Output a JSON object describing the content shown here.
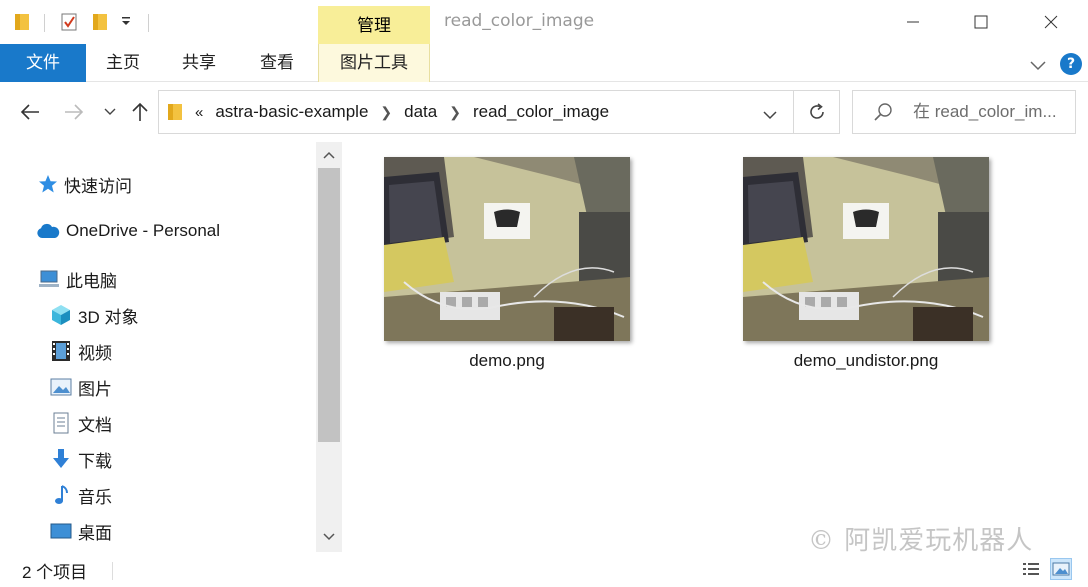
{
  "titlebar": {
    "context_tab": "管理",
    "window_title": "read_color_image"
  },
  "ribbon": {
    "tabs": [
      {
        "label": "文件"
      },
      {
        "label": "主页"
      },
      {
        "label": "共享"
      },
      {
        "label": "查看"
      },
      {
        "label": "图片工具"
      }
    ],
    "help_label": "?"
  },
  "address": {
    "lead": "«",
    "crumbs": [
      "astra-basic-example",
      "data",
      "read_color_image"
    ],
    "search_placeholder": "在 read_color_im..."
  },
  "nav": {
    "items": [
      {
        "label": "快速访问",
        "icon": "star-icon"
      },
      {
        "label": "OneDrive - Personal",
        "icon": "cloud-icon"
      },
      {
        "label": "此电脑",
        "icon": "computer-icon"
      },
      {
        "label": "3D 对象",
        "icon": "cube-icon"
      },
      {
        "label": "视频",
        "icon": "film-icon"
      },
      {
        "label": "图片",
        "icon": "picture-icon"
      },
      {
        "label": "文档",
        "icon": "document-icon"
      },
      {
        "label": "下载",
        "icon": "download-icon"
      },
      {
        "label": "音乐",
        "icon": "music-icon"
      },
      {
        "label": "桌面",
        "icon": "desktop-icon"
      }
    ]
  },
  "files": [
    {
      "name": "demo.png"
    },
    {
      "name": "demo_undistor.png"
    }
  ],
  "status": {
    "count": "2 个项目"
  },
  "watermark": "© 阿凯爱玩机器人",
  "colors": {
    "accent": "#1979ca",
    "context_tab": "#f8ee98"
  }
}
